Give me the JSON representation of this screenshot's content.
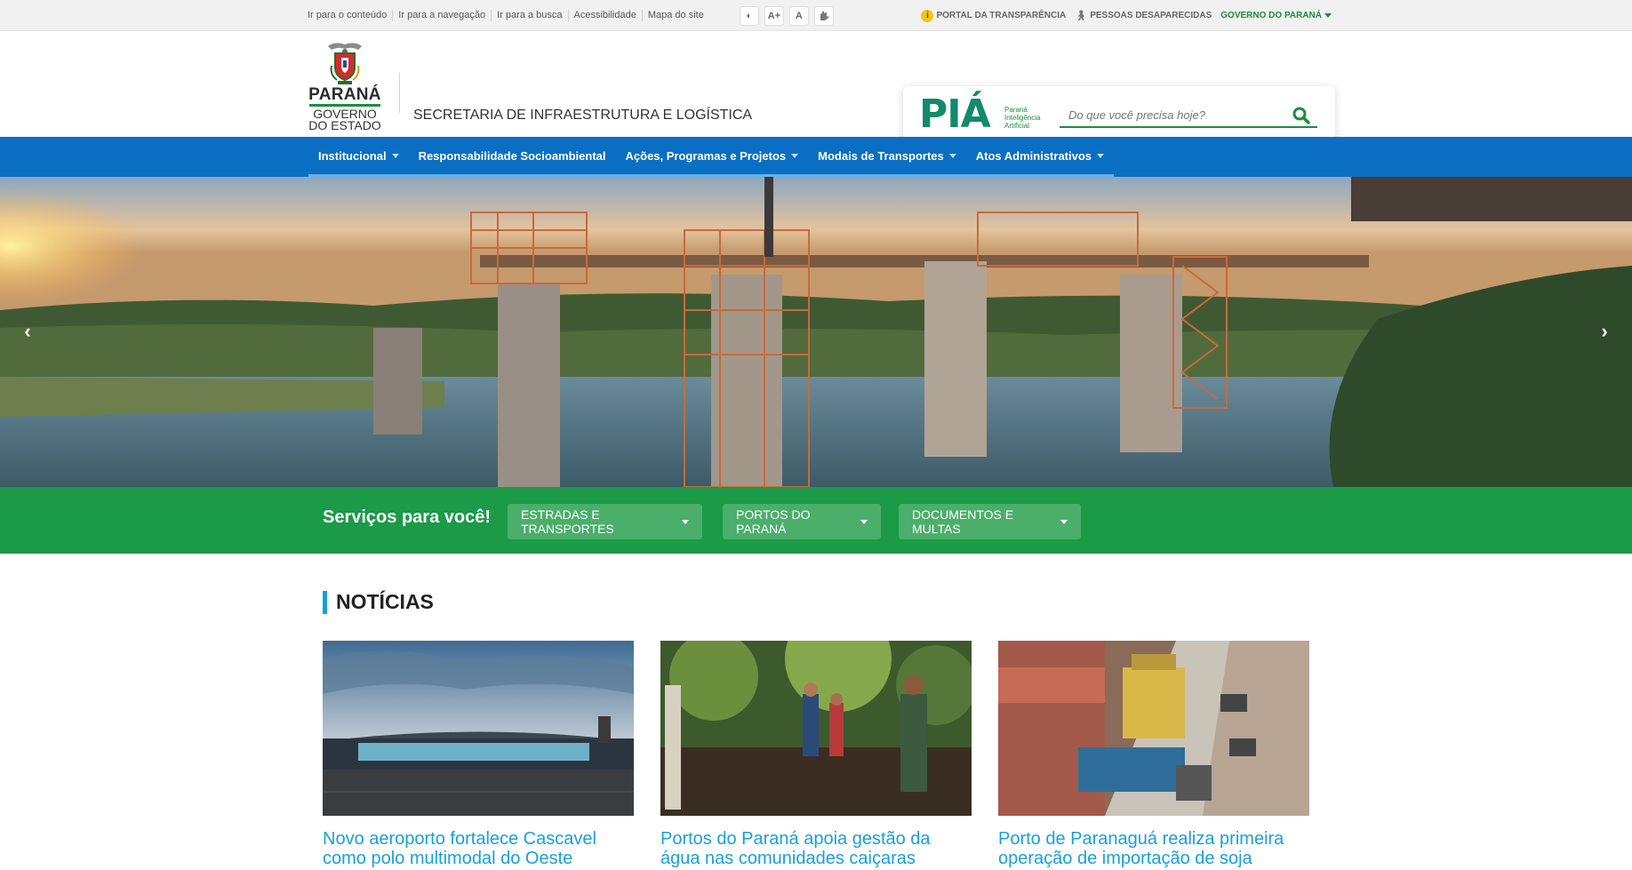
{
  "topbar": {
    "skip_links": [
      "Ir para o conteúdo",
      "Ir para a navegação",
      "Ir para a busca",
      "Acessibilidade",
      "Mapa do site"
    ],
    "a11y_buttons": [
      "◐",
      "A+",
      "A",
      "hand-sign-icon"
    ],
    "transparencia": "PORTAL DA TRANSPARÊNCIA",
    "desaparecidas": "PESSOAS DESAPARECIDAS",
    "governo": "GOVERNO DO PARANÁ"
  },
  "header": {
    "brand_word": "PARANÁ",
    "brand_gov_line1": "GOVERNO",
    "brand_gov_line2": "DO ESTADO",
    "secretaria": "SECRETARIA DE INFRAESTRUTURA E LOGÍSTICA",
    "pia": {
      "logo": "PIÁ",
      "sub_line1": "Paraná",
      "sub_line2": "Inteligência",
      "sub_line3": "Artificial"
    },
    "search_placeholder": "Do que você precisa hoje?"
  },
  "nav": {
    "items": [
      {
        "label": "Institucional",
        "dropdown": true
      },
      {
        "label": "Responsabilidade Socioambiental",
        "dropdown": false
      },
      {
        "label": "Ações, Programas e Projetos",
        "dropdown": true
      },
      {
        "label": "Modais de Transportes",
        "dropdown": true
      },
      {
        "label": "Atos Administrativos",
        "dropdown": true
      }
    ]
  },
  "hero": {
    "prev_icon": "‹",
    "next_icon": "›"
  },
  "services": {
    "title": "Serviços para você!",
    "buttons": [
      "ESTRADAS E TRANSPORTES",
      "PORTOS DO PARANÁ",
      "DOCUMENTOS E MULTAS"
    ]
  },
  "news": {
    "heading": "NOTÍCIAS",
    "cards": [
      {
        "title_line1": "Novo aeroporto fortalece Cascavel",
        "title_line2": "como polo multimodal do Oeste"
      },
      {
        "title_line1": "Portos do Paraná apoia gestão da",
        "title_line2": "água nas comunidades caiçaras"
      },
      {
        "title_line1": "Porto de Paranaguá realiza primeira",
        "title_line2": "operação de importação de soja"
      }
    ]
  },
  "colors": {
    "nav_blue": "#0a6fc2",
    "services_green": "#1b9a48",
    "news_link": "#1aa0d8",
    "accent_green": "#1c8d3d"
  }
}
